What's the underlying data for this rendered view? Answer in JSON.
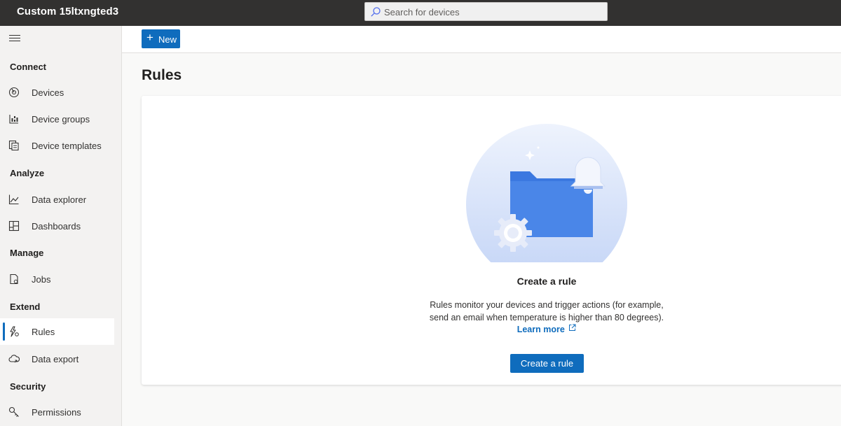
{
  "app": {
    "title": "Custom 15ltxngted3"
  },
  "search": {
    "placeholder": "Search for devices"
  },
  "sidebar": {
    "sections": [
      {
        "label": "Connect",
        "items": [
          {
            "label": "Devices",
            "icon": "devices-icon"
          },
          {
            "label": "Device groups",
            "icon": "device-groups-icon"
          },
          {
            "label": "Device templates",
            "icon": "device-templates-icon"
          }
        ]
      },
      {
        "label": "Analyze",
        "items": [
          {
            "label": "Data explorer",
            "icon": "chart-line-icon"
          },
          {
            "label": "Dashboards",
            "icon": "dashboard-icon"
          }
        ]
      },
      {
        "label": "Manage",
        "items": [
          {
            "label": "Jobs",
            "icon": "jobs-icon"
          }
        ]
      },
      {
        "label": "Extend",
        "items": [
          {
            "label": "Rules",
            "icon": "rules-icon",
            "active": true
          },
          {
            "label": "Data export",
            "icon": "cloud-export-icon"
          }
        ]
      },
      {
        "label": "Security",
        "items": [
          {
            "label": "Permissions",
            "icon": "key-icon"
          }
        ]
      }
    ]
  },
  "toolbar": {
    "new_label": "New"
  },
  "page": {
    "title": "Rules"
  },
  "empty_state": {
    "title": "Create a rule",
    "description_line1": "Rules monitor your devices and trigger actions (for example,",
    "description_line2": "send an email when temperature is higher than 80 degrees).",
    "learn_more": "Learn more",
    "button": "Create a rule"
  },
  "colors": {
    "accent": "#0f6cbd",
    "topbar": "#323130",
    "sidebar": "#f3f2f1"
  }
}
